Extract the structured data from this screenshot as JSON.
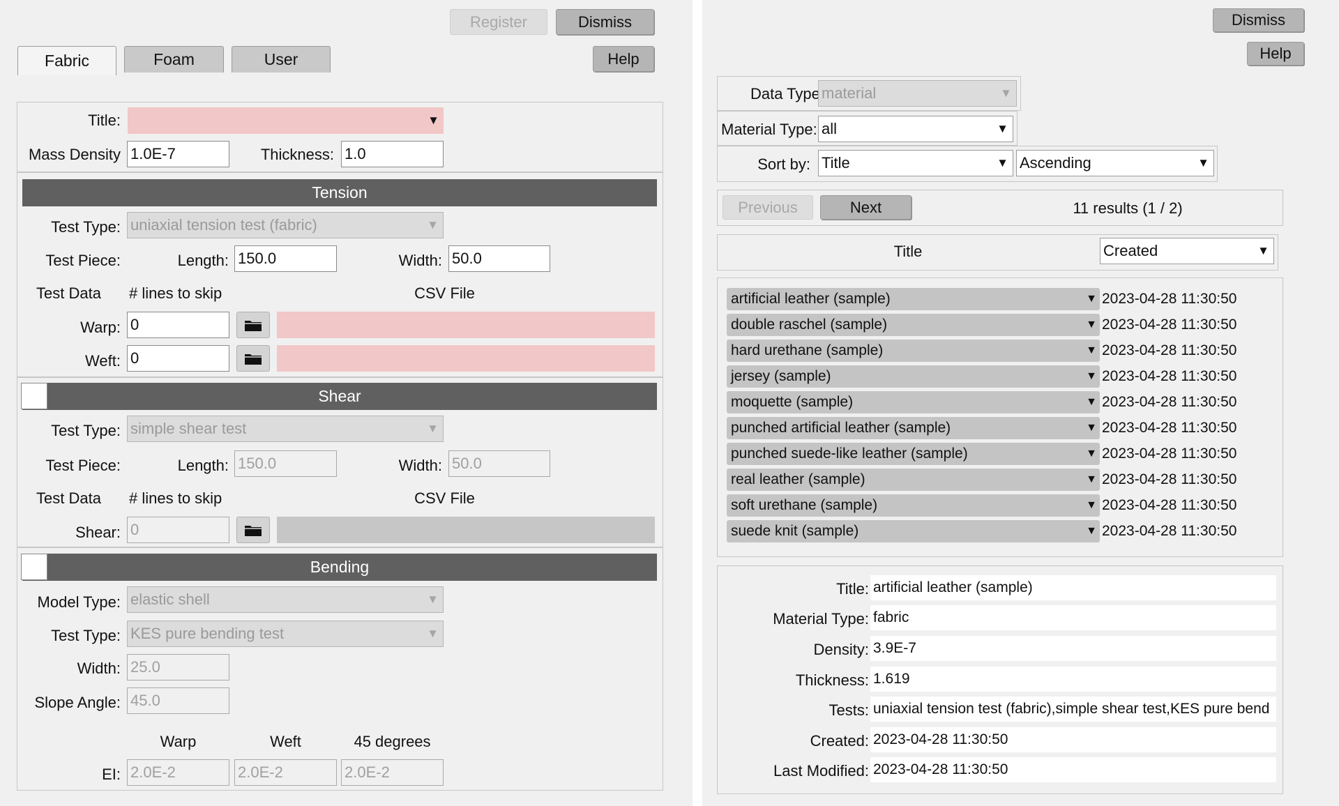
{
  "left": {
    "toolbar": {
      "register": "Register",
      "dismiss": "Dismiss",
      "help": "Help"
    },
    "tabs": [
      {
        "label": "Fabric",
        "active": true
      },
      {
        "label": "Foam"
      },
      {
        "label": "User"
      }
    ],
    "general": {
      "title_label": "Title:",
      "title_value": "",
      "mass_density_label": "Mass Density",
      "mass_density_value": "1.0E-7",
      "thickness_label": "Thickness:",
      "thickness_value": "1.0"
    },
    "tension": {
      "header": "Tension",
      "test_type_label": "Test Type:",
      "test_type_value": "uniaxial tension test (fabric)",
      "test_piece_label": "Test Piece:",
      "length_label": "Length:",
      "length_value": "150.0",
      "width_label": "Width:",
      "width_value": "50.0",
      "test_data_label": "Test Data",
      "lines_to_skip_label": "# lines to skip",
      "csv_file_label": "CSV File",
      "warp_label": "Warp:",
      "warp_skip": "0",
      "warp_csv": "",
      "weft_label": "Weft:",
      "weft_skip": "0",
      "weft_csv": ""
    },
    "shear": {
      "header": "Shear",
      "enabled": false,
      "test_type_label": "Test Type:",
      "test_type_value": "simple shear test",
      "test_piece_label": "Test Piece:",
      "length_label": "Length:",
      "length_value": "150.0",
      "width_label": "Width:",
      "width_value": "50.0",
      "test_data_label": "Test Data",
      "lines_to_skip_label": "# lines to skip",
      "csv_file_label": "CSV File",
      "shear_label": "Shear:",
      "shear_skip": "0",
      "shear_csv": ""
    },
    "bending": {
      "header": "Bending",
      "enabled": false,
      "model_type_label": "Model Type:",
      "model_type_value": "elastic shell",
      "test_type_label": "Test Type:",
      "test_type_value": "KES pure bending test",
      "width_label": "Width:",
      "width_value": "25.0",
      "slope_angle_label": "Slope Angle:",
      "slope_angle_value": "45.0",
      "col_warp": "Warp",
      "col_weft": "Weft",
      "col_45": "45 degrees",
      "ei_label": "EI:",
      "ei_warp": "2.0E-2",
      "ei_weft": "2.0E-2",
      "ei_45": "2.0E-2"
    }
  },
  "right": {
    "dismiss": "Dismiss",
    "help": "Help",
    "filters": {
      "data_type_label": "Data Type:",
      "data_type_value": "material",
      "material_type_label": "Material Type:",
      "material_type_value": "all",
      "sort_by_label": "Sort by:",
      "sort_by_value": "Title",
      "sort_order_value": "Ascending"
    },
    "pager": {
      "previous": "Previous",
      "next": "Next",
      "results": "11 results (1 / 2)"
    },
    "columns": {
      "title": "Title",
      "second": "Created"
    },
    "rows": [
      {
        "name": "artificial leather (sample)",
        "date": "2023-04-28 11:30:50"
      },
      {
        "name": "double raschel (sample)",
        "date": "2023-04-28 11:30:50"
      },
      {
        "name": "hard urethane (sample)",
        "date": "2023-04-28 11:30:50"
      },
      {
        "name": "jersey (sample)",
        "date": "2023-04-28 11:30:50"
      },
      {
        "name": "moquette (sample)",
        "date": "2023-04-28 11:30:50"
      },
      {
        "name": "punched artificial leather (sample)",
        "date": "2023-04-28 11:30:50"
      },
      {
        "name": "punched suede-like leather (sample)",
        "date": "2023-04-28 11:30:50"
      },
      {
        "name": "real leather (sample)",
        "date": "2023-04-28 11:30:50"
      },
      {
        "name": "soft urethane (sample)",
        "date": "2023-04-28 11:30:50"
      },
      {
        "name": "suede knit (sample)",
        "date": "2023-04-28 11:30:50"
      }
    ],
    "details": {
      "title_label": "Title:",
      "title_value": "artificial leather (sample)",
      "material_type_label": "Material Type:",
      "material_type_value": "fabric",
      "density_label": "Density:",
      "density_value": "3.9E-7",
      "thickness_label": "Thickness:",
      "thickness_value": "1.619",
      "tests_label": "Tests:",
      "tests_value": "uniaxial tension test (fabric),simple shear test,KES pure bend",
      "created_label": "Created:",
      "created_value": "2023-04-28 11:30:50",
      "modified_label": "Last Modified:",
      "modified_value": "2023-04-28 11:30:50"
    }
  }
}
